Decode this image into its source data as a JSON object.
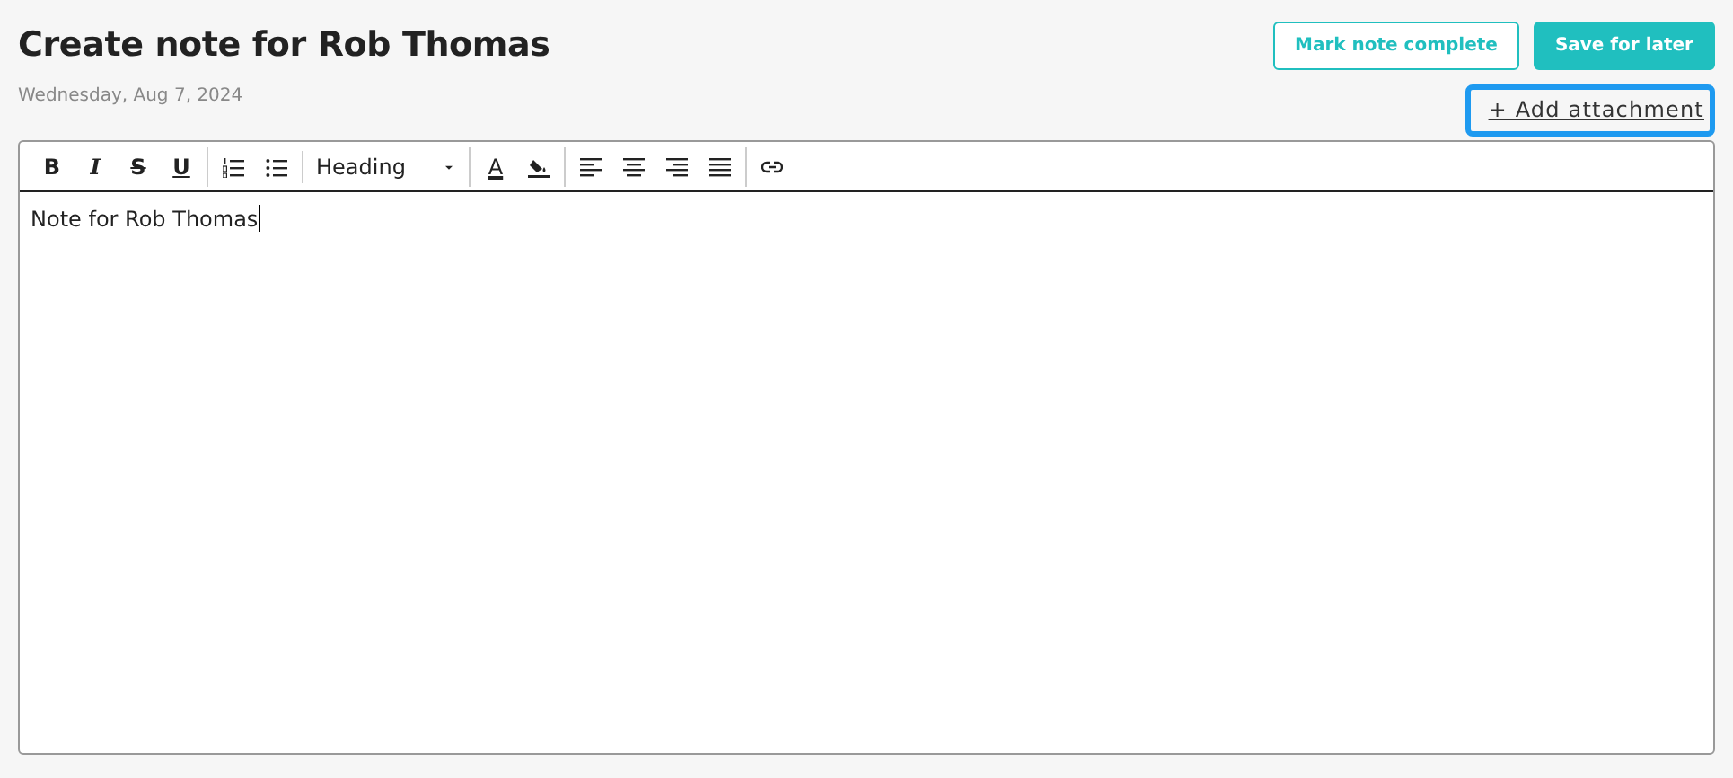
{
  "header": {
    "title": "Create note for Rob Thomas",
    "date": "Wednesday, Aug 7, 2024"
  },
  "actions": [
    {
      "label": "Mark note complete",
      "kind": "outline"
    },
    {
      "label": "Save for later",
      "kind": "solid"
    }
  ],
  "attachment_link": {
    "label": "+ Add attachment",
    "focused": true
  },
  "toolbar": [
    [
      {
        "kind": "bold",
        "label": "B"
      },
      {
        "kind": "italic",
        "label": "I"
      },
      {
        "kind": "strike",
        "label": "S"
      },
      {
        "kind": "underline",
        "label": "U"
      }
    ],
    [
      {
        "kind": "ordered-list"
      },
      {
        "kind": "bullet-list"
      }
    ],
    [
      {
        "kind": "dropdown",
        "label": "Heading"
      }
    ],
    [
      {
        "kind": "text-color",
        "label": "A"
      },
      {
        "kind": "highlight"
      }
    ],
    [
      {
        "kind": "align-left"
      },
      {
        "kind": "align-center"
      },
      {
        "kind": "align-right"
      },
      {
        "kind": "justify"
      }
    ],
    [
      {
        "kind": "link"
      }
    ]
  ],
  "editor": {
    "text": "Note for Rob Thomas",
    "caret": true
  }
}
